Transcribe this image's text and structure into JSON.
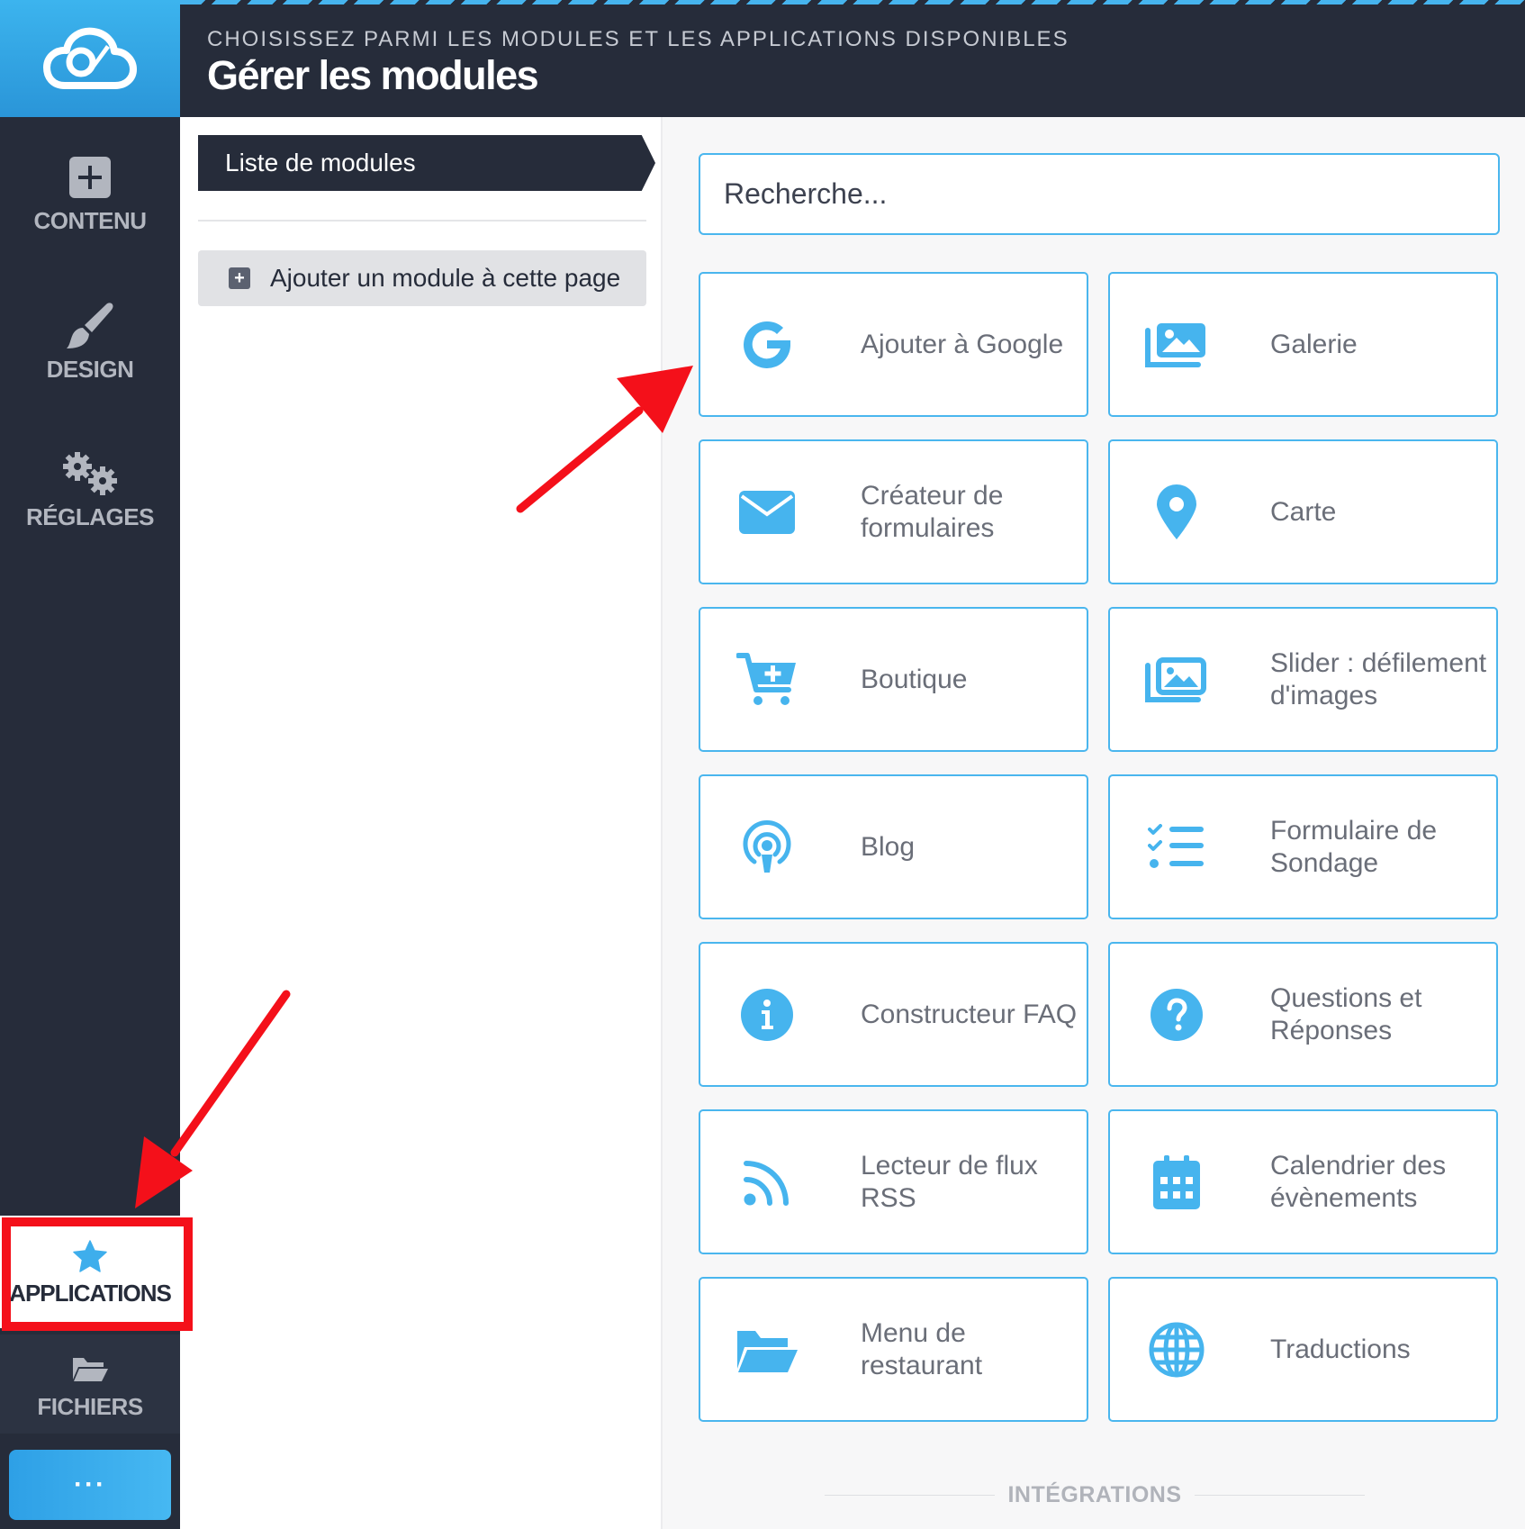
{
  "sidebar": {
    "logo_icon": "cloud-brush-logo",
    "items": [
      {
        "label": "CONTENU",
        "icon": "plus-square-icon"
      },
      {
        "label": "DESIGN",
        "icon": "brush-icon"
      },
      {
        "label": "RÉGLAGES",
        "icon": "gears-icon"
      },
      {
        "label": "APPLICATIONS",
        "icon": "star-icon",
        "active": true
      },
      {
        "label": "FICHIERS",
        "icon": "folder-open-icon"
      }
    ],
    "more_label": "···"
  },
  "header": {
    "subtitle": "CHOISISSEZ PARMI LES MODULES ET LES APPLICATIONS DISPONIBLES",
    "title": "Gérer les modules"
  },
  "left_panel": {
    "tab_label": "Liste de modules",
    "add_button_label": "Ajouter un module à cette page"
  },
  "search": {
    "placeholder": "Recherche..."
  },
  "modules": [
    {
      "label": "Ajouter à Google",
      "icon": "google-icon"
    },
    {
      "label": "Galerie",
      "icon": "gallery-icon"
    },
    {
      "label": "Créateur de formulaires",
      "icon": "envelope-icon"
    },
    {
      "label": "Carte",
      "icon": "map-pin-icon"
    },
    {
      "label": "Boutique",
      "icon": "cart-plus-icon"
    },
    {
      "label": "Slider : défilement d'images",
      "icon": "images-icon"
    },
    {
      "label": "Blog",
      "icon": "podcast-icon"
    },
    {
      "label": "Formulaire de Sondage",
      "icon": "checklist-icon"
    },
    {
      "label": "Constructeur FAQ",
      "icon": "info-circle-icon"
    },
    {
      "label": "Questions et Réponses",
      "icon": "question-circle-icon"
    },
    {
      "label": "Lecteur de flux RSS",
      "icon": "rss-icon"
    },
    {
      "label": "Calendrier des évènements",
      "icon": "calendar-icon"
    },
    {
      "label": "Menu de restaurant",
      "icon": "folder-open-icon"
    },
    {
      "label": "Traductions",
      "icon": "globe-icon"
    }
  ],
  "section_label": "INTÉGRATIONS",
  "colors": {
    "accent": "#46b4ee",
    "sidebar_bg": "#262c3a",
    "annotation_red": "#f4101a"
  }
}
